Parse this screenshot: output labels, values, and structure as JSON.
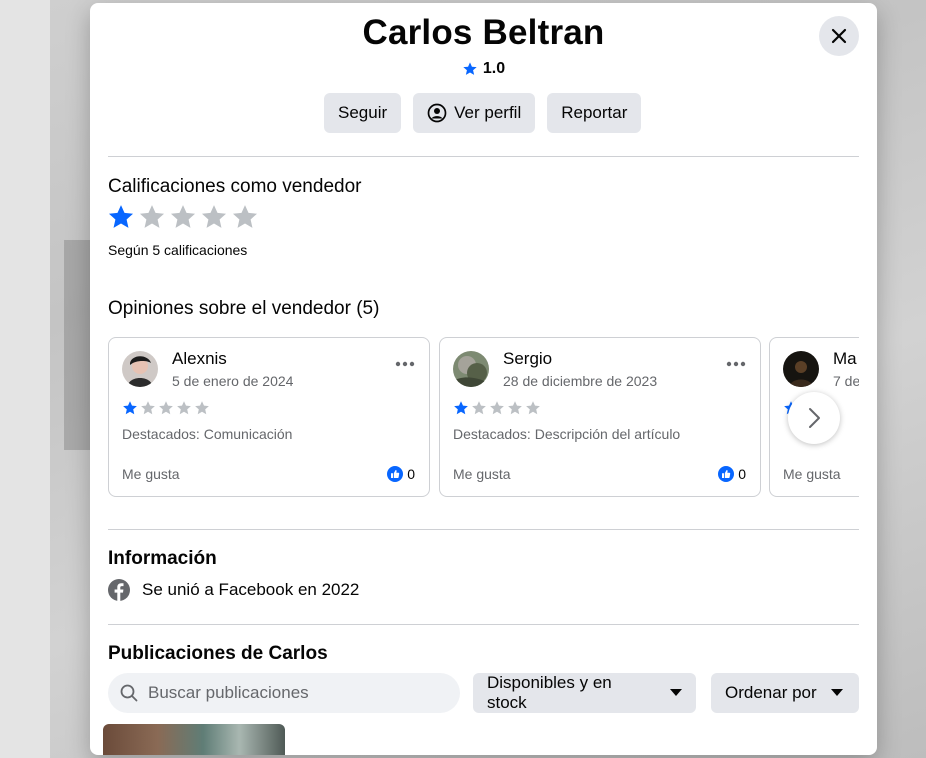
{
  "profile": {
    "name": "Carlos Beltran",
    "rating": "1.0"
  },
  "actions": {
    "follow": "Seguir",
    "view_profile": "Ver perfil",
    "report": "Reportar"
  },
  "seller_ratings": {
    "title": "Calificaciones como vendedor",
    "stars_filled": 1,
    "stars_total": 5,
    "count_text": "Según 5 calificaciones"
  },
  "reviews": {
    "title": "Opiniones sobre el vendedor",
    "count": "(5)",
    "items": [
      {
        "name": "Alexnis",
        "date": "5 de enero de 2024",
        "stars_filled": 1,
        "highlight": "Destacados: Comunicación",
        "like_label": "Me gusta",
        "likes": "0"
      },
      {
        "name": "Sergio",
        "date": "28 de diciembre de 2023",
        "stars_filled": 1,
        "highlight": "Destacados: Descripción del artículo",
        "like_label": "Me gusta",
        "likes": "0"
      },
      {
        "name": "Ma",
        "date": "7 de",
        "stars_filled": 1,
        "highlight": "",
        "like_label": "Me gusta",
        "likes": ""
      }
    ]
  },
  "info": {
    "title": "Información",
    "joined": "Se unió a Facebook en 2022"
  },
  "posts": {
    "title": "Publicaciones de Carlos",
    "search_placeholder": "Buscar publicaciones",
    "filter_label": "Disponibles y en stock",
    "sort_label": "Ordenar por"
  },
  "colors": {
    "accent": "#0866ff",
    "star_empty": "#bcc0c4",
    "button_bg": "#e4e6eb",
    "secondary_text": "#65676b"
  },
  "icons": {
    "close": "close-icon",
    "star": "star-icon",
    "profile": "user-circle-icon",
    "more": "more-horizontal-icon",
    "like": "thumbs-up-icon",
    "next": "chevron-right-icon",
    "facebook": "facebook-icon",
    "search": "search-icon",
    "caret": "caret-down-icon"
  }
}
